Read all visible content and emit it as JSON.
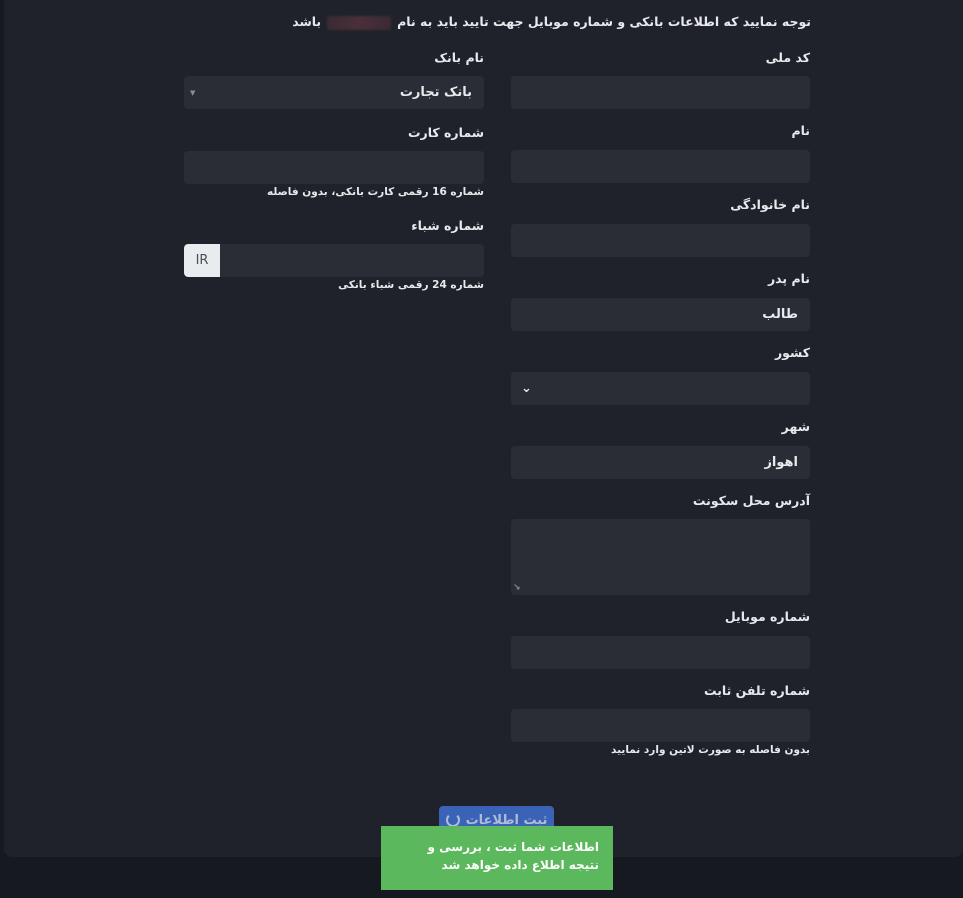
{
  "notice": {
    "prefix": "توجه نمایید که اطلاعات بانکی و شماره موبایل جهت تایید باید به نام",
    "suffix": "باشد"
  },
  "right_column": {
    "national_code": {
      "label": "کد ملی",
      "value": ""
    },
    "first_name": {
      "label": "نام",
      "value": ""
    },
    "last_name": {
      "label": "نام خانوادگی",
      "value": ""
    },
    "father_name": {
      "label": "نام پدر",
      "value": "طالب"
    },
    "country": {
      "label": "کشور",
      "value": ""
    },
    "city": {
      "label": "شهر",
      "value": "اهواز"
    },
    "address": {
      "label": "آدرس محل سکونت",
      "value": ""
    },
    "mobile": {
      "label": "شماره موبایل",
      "value": ""
    },
    "landline": {
      "label": "شماره تلفن ثابت",
      "value": "",
      "help": "بدون فاصله به صورت لاتین وارد نمایید"
    }
  },
  "left_column": {
    "bank_name": {
      "label": "نام بانک",
      "value": "بانک تجارت"
    },
    "card_number": {
      "label": "شماره کارت",
      "value": "",
      "help": "شماره 16 رقمی کارت بانکی، بدون فاصله"
    },
    "sheba": {
      "label": "شماره شباء",
      "prefix": "IR",
      "value": "",
      "help": "شماره 24 رقمی شباء بانکی"
    }
  },
  "submit": {
    "label": "ثبت اطلاعات"
  },
  "toast": {
    "message": "اطلاعات شما ثبت ، بررسی و نتیجه اطلاع داده خواهد شد"
  },
  "icons": {
    "country_select": "chevron-down-icon",
    "bank_select": "caret-down-icon",
    "submit": "spinner-icon",
    "address_resize": "resize-handle-icon"
  }
}
